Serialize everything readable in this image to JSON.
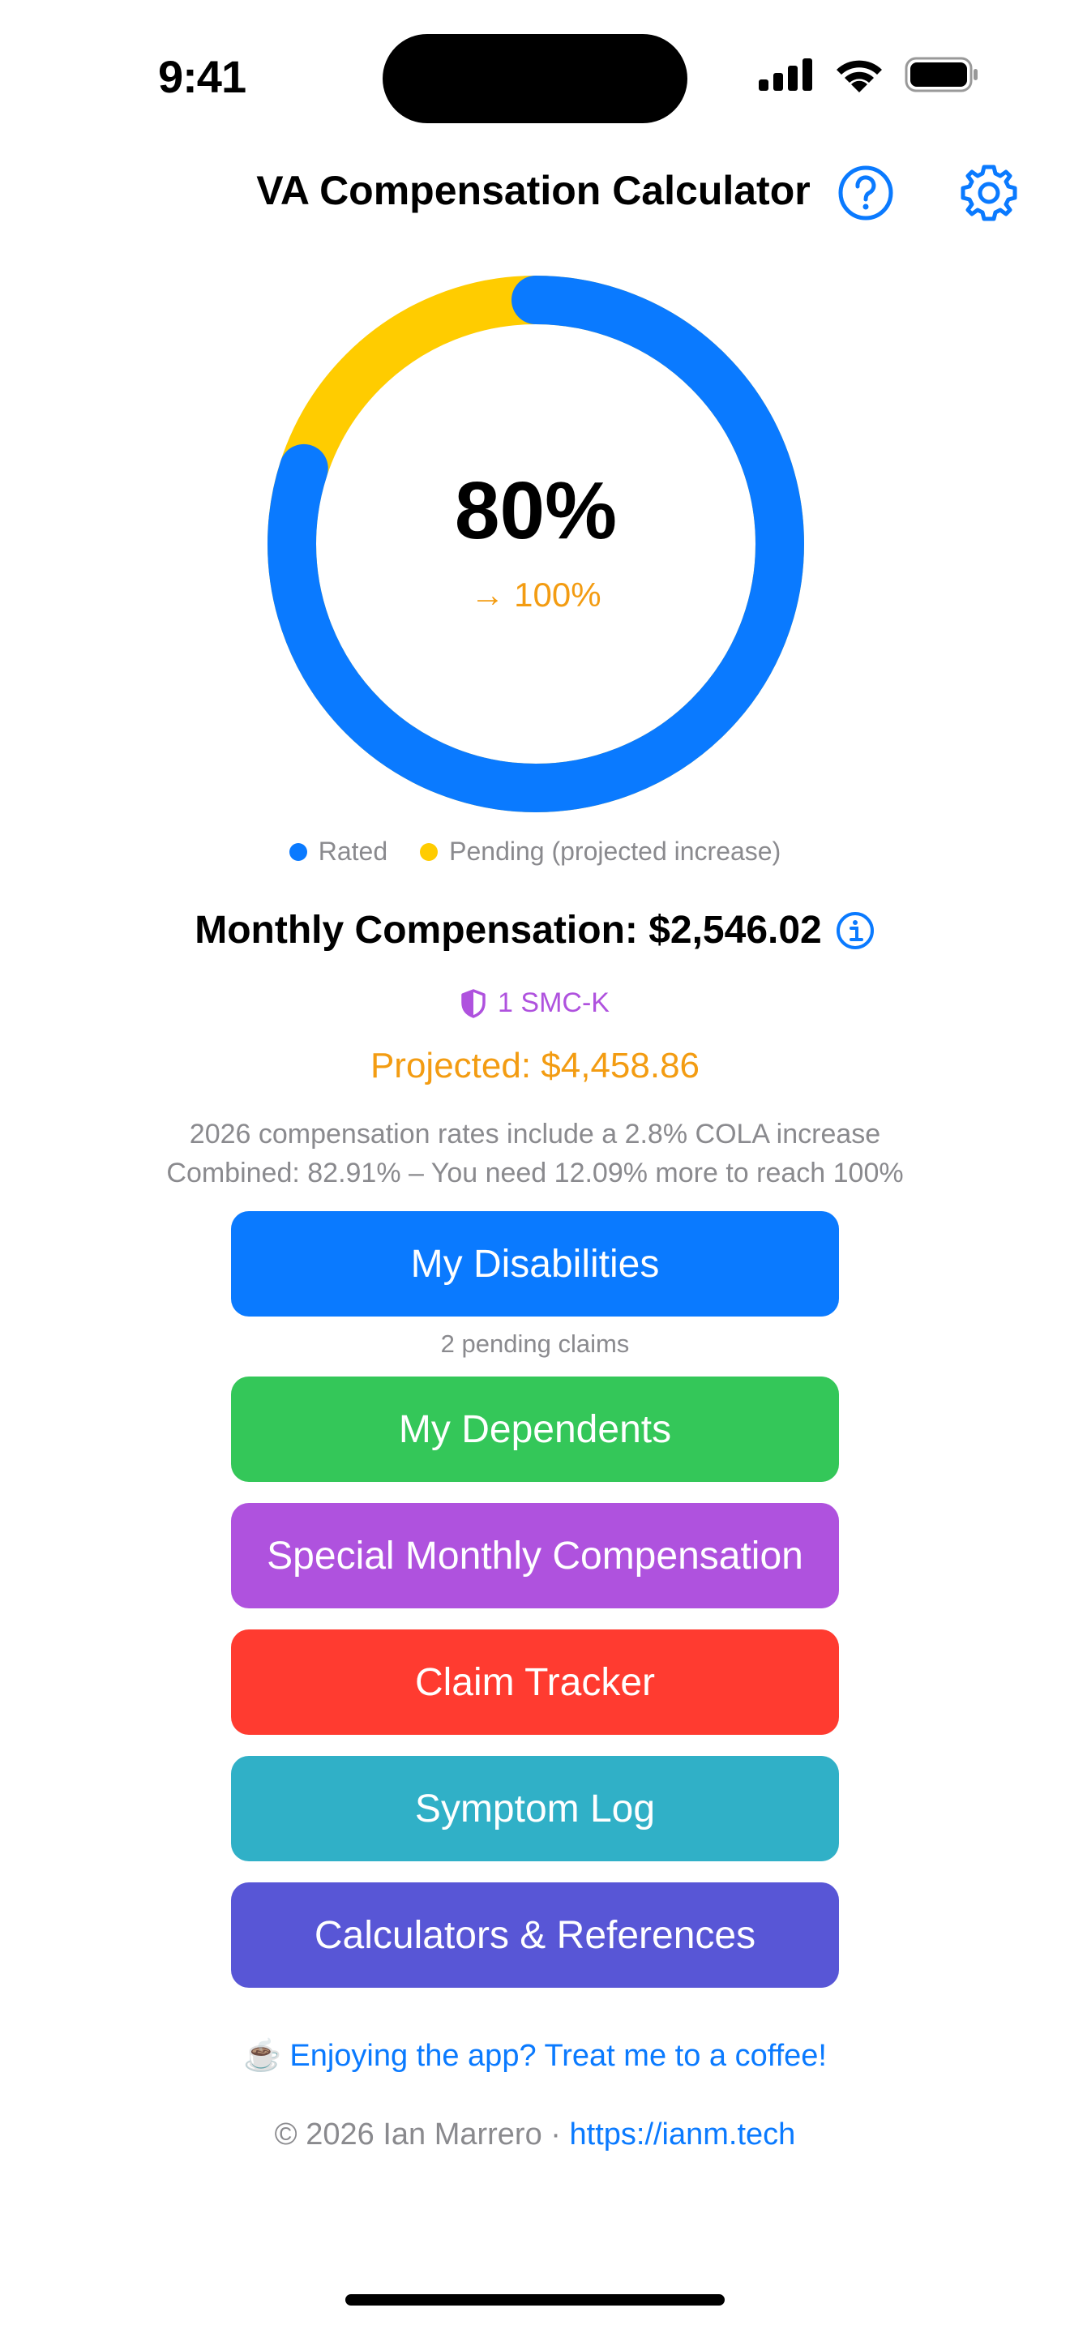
{
  "status_bar": {
    "time": "9:41"
  },
  "header": {
    "title": "VA Compensation Calculator",
    "help_icon": "question-circle-icon",
    "settings_icon": "gear-icon"
  },
  "ring": {
    "current_percent_label": "80%",
    "target_percent_label": "→ 100%",
    "rated_fraction": 0.8,
    "pending_fraction": 0.2,
    "colors": {
      "rated": "#0A7AFF",
      "pending": "#FFCC00",
      "target_text": "#F39C12"
    }
  },
  "legend": {
    "rated": "Rated",
    "pending": "Pending (projected increase)"
  },
  "compensation": {
    "label": "Monthly Compensation: $2,546.02",
    "smc": "1 SMC-K",
    "projected": "Projected: $4,458.86",
    "cola_note": "2026 compensation rates include a 2.8% COLA increase",
    "combined_note": "Combined: 82.91% – You need 12.09% more to reach 100%"
  },
  "buttons": {
    "disabilities": "My Disabilities",
    "pending_claims": "2 pending claims",
    "dependents": "My Dependents",
    "smc": "Special Monthly Compensation",
    "claim_tracker": "Claim Tracker",
    "symptom_log": "Symptom Log",
    "calculators": "Calculators & References"
  },
  "footer": {
    "coffee_emoji": "☕️",
    "coffee_text": "Enjoying the app? Treat me to a coffee!",
    "copyright": "© 2026 Ian Marrero · ",
    "link": "https://ianm.tech"
  }
}
